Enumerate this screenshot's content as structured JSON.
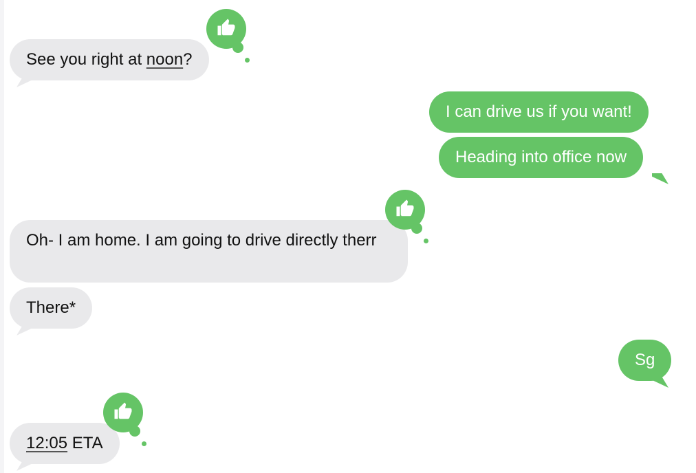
{
  "messages": [
    {
      "id": "m1",
      "direction": "incoming",
      "text_before": "See you right at ",
      "link": "noon",
      "text_after": "?",
      "reaction": "thumbs-up"
    },
    {
      "id": "m2",
      "direction": "outgoing",
      "text": "I can drive us if you want!"
    },
    {
      "id": "m3",
      "direction": "outgoing",
      "text": "Heading into office now"
    },
    {
      "id": "m4",
      "direction": "incoming",
      "text": "Oh- I am home.  I am going to drive directly therr",
      "reaction": "thumbs-up"
    },
    {
      "id": "m5",
      "direction": "incoming",
      "text": "There*"
    },
    {
      "id": "m6",
      "direction": "outgoing",
      "text": "Sg"
    },
    {
      "id": "m7",
      "direction": "incoming",
      "link": "12:05",
      "text_after": " ETA",
      "reaction": "thumbs-up"
    }
  ],
  "colors": {
    "incoming_bubble": "#e9e9eb",
    "outgoing_bubble": "#65c466",
    "reaction_badge": "#65c466"
  },
  "icons": {
    "reaction": "thumbs-up-icon"
  }
}
